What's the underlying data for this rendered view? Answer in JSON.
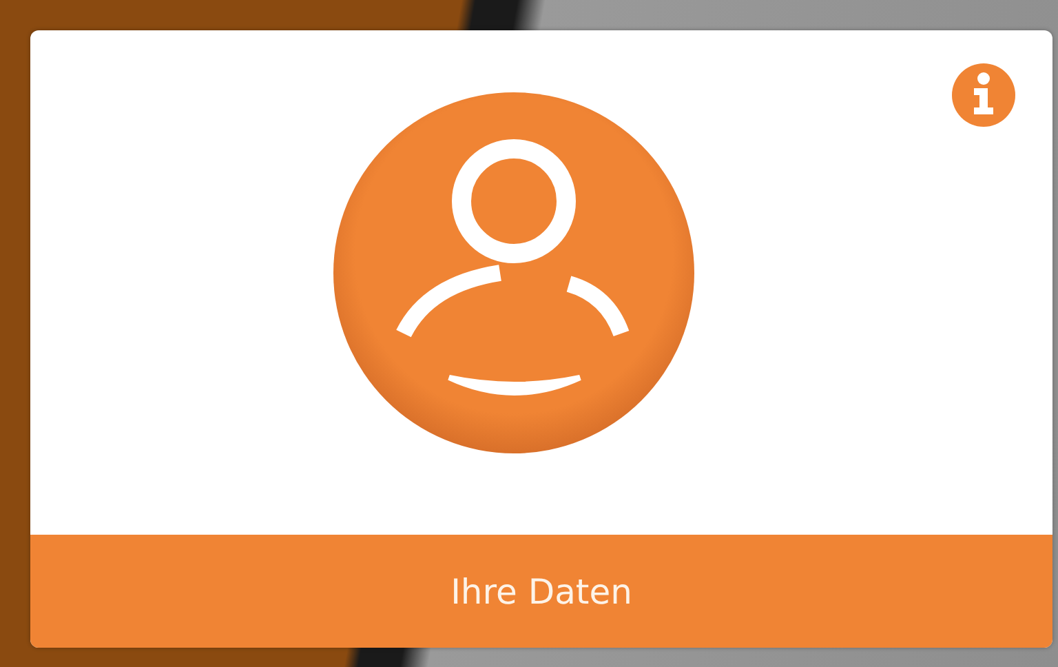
{
  "card": {
    "label": "Ihre Daten"
  }
}
